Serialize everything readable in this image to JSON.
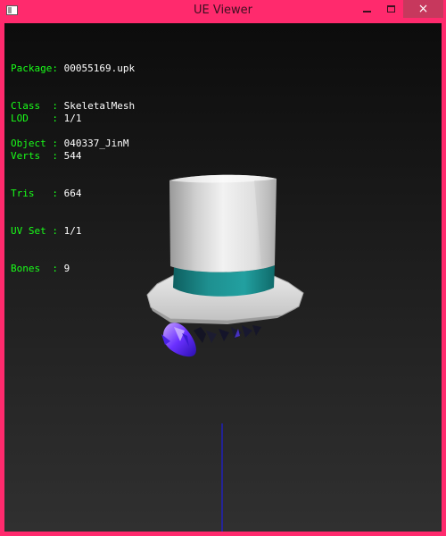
{
  "window": {
    "title": "UE Viewer",
    "icon": "app-window-icon",
    "controls": {
      "minimize": "minimize-icon",
      "maximize": "maximize-icon",
      "close": "×"
    }
  },
  "info": {
    "package": {
      "label": "Package:",
      "value": "00055169.upk"
    },
    "class": {
      "label": "Class  :",
      "value": "SkeletalMesh"
    },
    "object": {
      "label": "Object :",
      "value": "040337_JinM"
    },
    "lod": {
      "label": "LOD    :",
      "value": "1/1"
    },
    "verts": {
      "label": "Verts  :",
      "value": "544"
    },
    "tris": {
      "label": "Tris   :",
      "value": "664"
    },
    "uvset": {
      "label": "UV Set :",
      "value": "1/1"
    },
    "bones": {
      "label": "Bones  :",
      "value": "9"
    }
  },
  "colors": {
    "frame": "#ff2a6d",
    "info_key": "#19ff19",
    "info_value": "#ffffff",
    "axis_line": "#1a1aff",
    "hat_band": "#1e8c8c"
  }
}
